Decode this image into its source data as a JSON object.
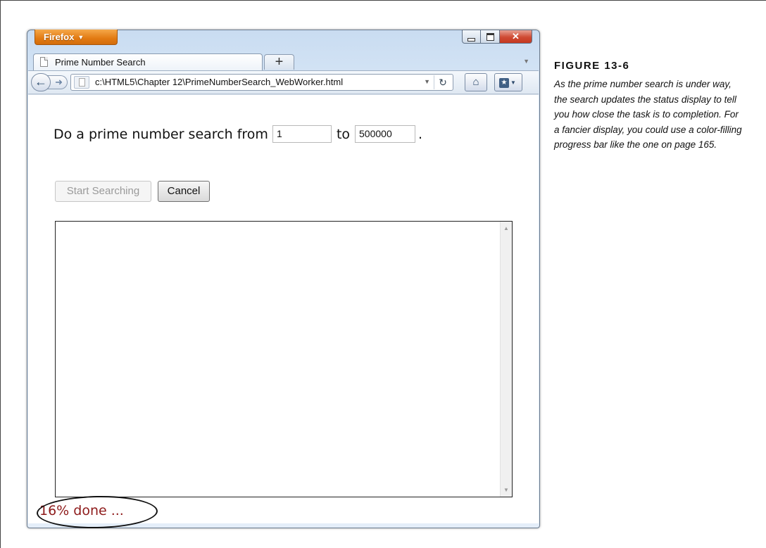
{
  "browser": {
    "app_button_label": "Firefox",
    "tab": {
      "title": "Prime Number Search"
    },
    "new_tab_label": "+",
    "url": "c:\\HTML5\\Chapter 12\\PrimeNumberSearch_WebWorker.html",
    "icons": {
      "back": "back-arrow-icon",
      "forward": "forward-arrow-icon",
      "reload": "reload-icon",
      "home": "home-icon",
      "bookmarks": "bookmarks-icon",
      "minimize": "minimize-icon",
      "maximize": "maximize-icon",
      "close": "close-icon"
    }
  },
  "page": {
    "prompt_prefix": "Do a prime number search from",
    "from_value": "1",
    "to_label": "to",
    "to_value": "500000",
    "prompt_suffix": ".",
    "start_button": "Start Searching",
    "cancel_button": "Cancel",
    "status": "16% done ..."
  },
  "figure": {
    "title": "FIGURE 13-6",
    "caption": "As the prime number search is under way, the search updates the status display to tell you how close the task is to completion. For a fancier display, you could use a color-filling progress bar like the one on page 165."
  }
}
